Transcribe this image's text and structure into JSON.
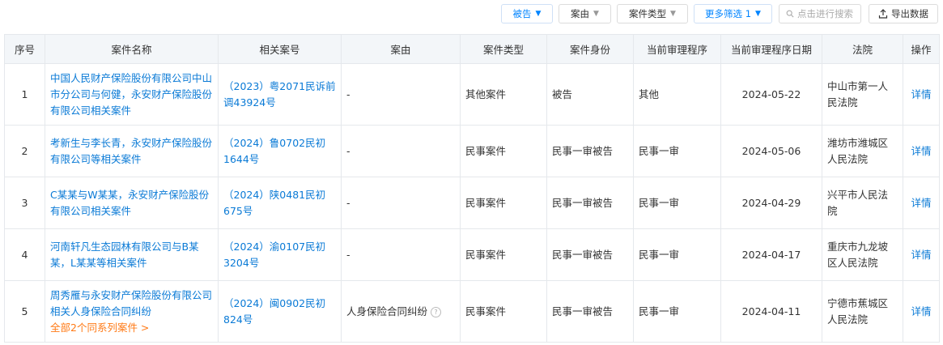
{
  "toolbar": {
    "filters": [
      {
        "label": "被告",
        "active": true
      },
      {
        "label": "案由",
        "active": false
      },
      {
        "label": "案件类型",
        "active": false
      },
      {
        "label": "更多筛选 1",
        "active": true
      }
    ],
    "search_placeholder": "点击进行搜索",
    "export_label": "导出数据"
  },
  "table": {
    "headers": [
      "序号",
      "案件名称",
      "相关案号",
      "案由",
      "案件类型",
      "案件身份",
      "当前审理程序",
      "当前审理程序日期",
      "法院",
      "操作"
    ],
    "rows": [
      {
        "index": "1",
        "name": "中国人民财产保险股份有限公司中山市分公司与何健，永安财产保险股份有限公司相关案件",
        "series": "",
        "case_no": "（2023）粤2071民诉前调43924号",
        "cause": "-",
        "cause_help": false,
        "type": "其他案件",
        "role": "被告",
        "procedure": "其他",
        "date": "2024-05-22",
        "court": "中山市第一人民法院",
        "action": "详情"
      },
      {
        "index": "2",
        "name": "考新生与李长青，永安财产保险股份有限公司等相关案件",
        "series": "",
        "case_no": "（2024）鲁0702民初1644号",
        "cause": "-",
        "cause_help": false,
        "type": "民事案件",
        "role": "民事一审被告",
        "procedure": "民事一审",
        "date": "2024-05-06",
        "court": "潍坊市潍城区人民法院",
        "action": "详情"
      },
      {
        "index": "3",
        "name": "C某某与W某某，永安财产保险股份有限公司相关案件",
        "series": "",
        "case_no": "（2024）陕0481民初675号",
        "cause": "-",
        "cause_help": false,
        "type": "民事案件",
        "role": "民事一审被告",
        "procedure": "民事一审",
        "date": "2024-04-29",
        "court": "兴平市人民法院",
        "action": "详情"
      },
      {
        "index": "4",
        "name": "河南轩凡生态园林有限公司与B某某，L某某等相关案件",
        "series": "",
        "case_no": "（2024）渝0107民初3204号",
        "cause": "-",
        "cause_help": false,
        "type": "民事案件",
        "role": "民事一审被告",
        "procedure": "民事一审",
        "date": "2024-04-17",
        "court": "重庆市九龙坡区人民法院",
        "action": "详情"
      },
      {
        "index": "5",
        "name": "周秀雁与永安财产保险股份有限公司相关人身保险合同纠纷",
        "series": "全部2个同系列案件 >",
        "case_no": "（2024）闽0902民初824号",
        "cause": "人身保险合同纠纷",
        "cause_help": true,
        "type": "民事案件",
        "role": "民事一审被告",
        "procedure": "民事一审",
        "date": "2024-04-11",
        "court": "宁德市蕉城区人民法院",
        "action": "详情"
      }
    ]
  },
  "colors": {
    "link": "#0a7ad6",
    "accent": "#0084ff",
    "series_link": "#ff7a16",
    "header_bg": "#f3f6f9",
    "border": "#e5e8ec"
  }
}
